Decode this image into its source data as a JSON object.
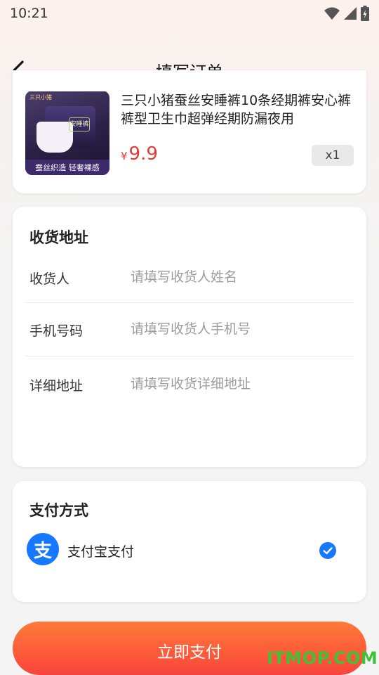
{
  "status_bar": {
    "time": "10:21"
  },
  "nav": {
    "title": "填写订单"
  },
  "product": {
    "title": "三只小猪蚕丝安睡裤10条经期裤安心裤裤型卫生巾超弹经期防漏夜用",
    "currency": "¥",
    "price": "9.9",
    "quantity": "x1",
    "image": {
      "brand_text": "三只小猪",
      "banner_text": "蚕丝织造 轻奢裸感",
      "package_label": "安睡裤"
    }
  },
  "address": {
    "title": "收货地址",
    "fields": [
      {
        "label": "收货人",
        "placeholder": "请填写收货人姓名"
      },
      {
        "label": "手机号码",
        "placeholder": "请填写收货人手机号"
      },
      {
        "label": "详细地址",
        "placeholder": "请填写收货详细地址"
      }
    ]
  },
  "payment": {
    "title": "支付方式",
    "method_icon_text": "支",
    "method_label": "支付宝支付",
    "selected": true,
    "accent_color": "#1677ff"
  },
  "pay_button": {
    "label": "立即支付"
  },
  "watermark": "ITMOP.COM",
  "colors": {
    "price": "#e53935",
    "button_start": "#ff7a3a",
    "button_end": "#f8453c"
  }
}
